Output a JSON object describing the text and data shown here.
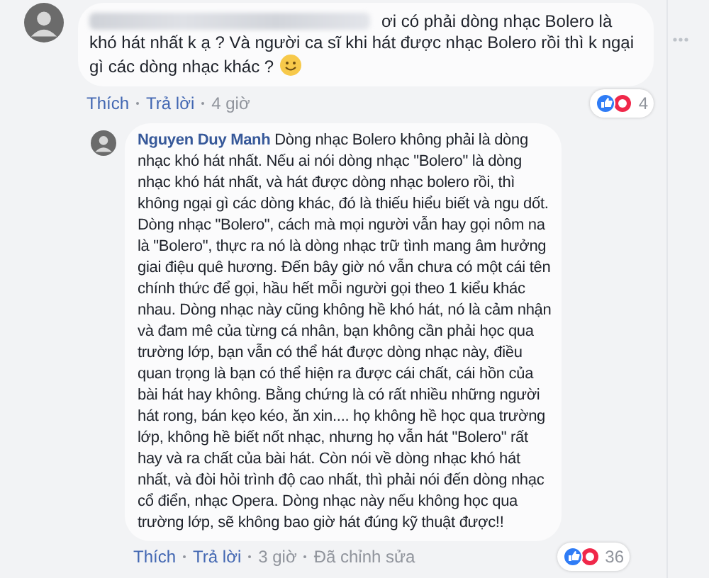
{
  "comments": [
    {
      "author_hidden": true,
      "text": "ơi có phải dòng nhạc Bolero là khó hát nhất k ạ ? Và người ca sĩ khi hát được nhạc Bolero rồi thì k ngại gì các dòng nhạc khác ?",
      "smiley": true,
      "like": "Thích",
      "reply": "Trả lời",
      "time": "4 giờ",
      "reaction_count": "4",
      "replies": [
        {
          "author_hidden": false,
          "author": "Nguyen Duy Manh",
          "text": "Dòng nhạc Bolero không phải là dòng nhạc khó hát nhất. Nếu ai nói dòng nhạc \"Bolero\" là dòng nhạc khó hát nhất, và hát được dòng nhạc bolero rồi, thì không ngại gì các dòng khác, đó là thiếu hiểu biết và ngu dốt. Dòng nhạc \"Bolero\", cách mà mọi người vẫn hay gọi nôm na là \"Bolero\", thực ra nó là dòng nhạc trữ tình mang âm hưởng giai điệu quê hương. Đến bây giờ nó vẫn chưa có một cái tên chính thức để gọi, hầu hết mỗi người gọi theo 1 kiểu khác nhau. Dòng nhạc này cũng không hề khó hát, nó là cảm nhận và đam mê của từng cá nhân, bạn không cần phải học qua trường lớp, bạn vẫn có thể hát được dòng nhạc này, điều quan trọng là bạn có thể hiện ra được cái chất, cái hồn của bài hát hay không. Bằng chứng là có rất nhiều những người hát rong, bán kẹo kéo, ăn xin.... họ không hề học qua trường lớp, không hề biết nốt nhạc, nhưng họ vẫn hát \"Bolero\" rất hay và ra chất của bài hát. Còn nói về dòng nhạc khó hát nhất, và đòi hỏi trình độ cao nhất, thì phải nói đến dòng nhạc cổ điển, nhạc Opera. Dòng nhạc này nếu không học qua trường lớp, sẽ không bao giờ hát đúng kỹ thuật được!!",
          "smiley": false,
          "like": "Thích",
          "reply": "Trả lời",
          "time": "3 giờ",
          "edited": "Đã chỉnh sửa",
          "reaction_count": "36"
        }
      ]
    }
  ]
}
